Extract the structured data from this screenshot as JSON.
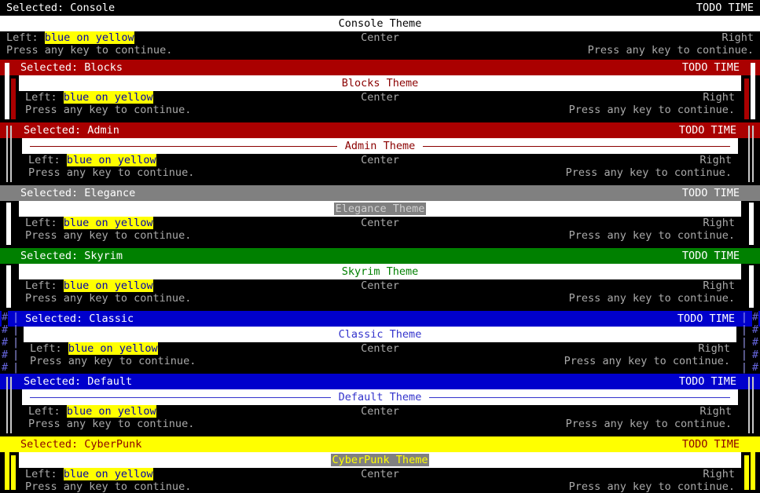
{
  "app": {
    "status_right": "TODO TIME",
    "selected_prefix": "Selected: ",
    "title_suffix": " Theme",
    "line_left_label": "Left: ",
    "line_left_value": "blue on yellow",
    "line_center": "Center",
    "line_right": "Right",
    "line_continue": "Press any key to continue."
  },
  "colors": {
    "black": "#000000",
    "white": "#ffffff",
    "grey_text": "#aaaaaa",
    "yellow": "#ffff00",
    "blue": "#0000aa",
    "maroon": "#aa0000",
    "dark_red_text": "#8b0000",
    "grey": "#808080",
    "light_grey": "#c0c0c0",
    "green": "#008000",
    "navy": "#0000cc"
  },
  "panels": [
    {
      "name": "Console",
      "selected_text": "Selected: Console",
      "title_text": "Console Theme",
      "status_right": "TODO TIME",
      "header_bg": "#000000",
      "header_fg": "#ffffff",
      "title_bg": "#ffffff",
      "title_fg": "#000000",
      "rule_color": "#ffffff",
      "rules": false,
      "border_color": "#000000",
      "border_style": "none",
      "gutter_char": "",
      "gutter_color": "#000000",
      "body_rows": [
        {
          "left_label": "Left: ",
          "left_value": "blue on yellow",
          "center": "Center",
          "right": "Right"
        },
        {
          "left_label": "Press any key to continue.",
          "left_value": "",
          "center": "",
          "right": "Press any key to continue."
        }
      ]
    },
    {
      "name": "Blocks",
      "selected_text": "Selected: Blocks",
      "title_text": "Blocks Theme",
      "status_right": "TODO TIME",
      "header_bg": "#aa0000",
      "header_fg": "#ffffff",
      "title_bg": "#ffffff",
      "title_fg": "#8b0000",
      "rule_color": "#ffffff",
      "rules": false,
      "border_color": "#ffffff",
      "border_style": "block",
      "gutter_char": "",
      "gutter_color": "#aa0000",
      "body_rows": [
        {
          "left_label": "Left: ",
          "left_value": "blue on yellow",
          "center": "Center",
          "right": "Right"
        },
        {
          "left_label": "Press any key to continue.",
          "left_value": "",
          "center": "",
          "right": "Press any key to continue."
        }
      ]
    },
    {
      "name": "Admin",
      "selected_text": "Selected: Admin",
      "title_text": "Admin Theme",
      "status_right": "TODO TIME",
      "header_bg": "#aa0000",
      "header_fg": "#ffffff",
      "title_bg": "#ffffff",
      "title_fg": "#8b0000",
      "rule_color": "#8b0000",
      "rules": true,
      "border_color": "#c8c8c8",
      "border_style": "double",
      "gutter_char": "",
      "gutter_color": "#aa0000",
      "body_rows": [
        {
          "left_label": "Left: ",
          "left_value": "blue on yellow",
          "center": "Center",
          "right": "Right"
        },
        {
          "left_label": "Press any key to continue.",
          "left_value": "",
          "center": "",
          "right": "Press any key to continue."
        }
      ]
    },
    {
      "name": "Elegance",
      "selected_text": "Selected: Elegance",
      "title_text": "Elegance Theme",
      "status_right": "TODO TIME",
      "header_bg": "#808080",
      "header_fg": "#ffffff",
      "title_bg": "#808080",
      "title_fg": "#d0d0d0",
      "rule_color": "#ffffff",
      "rules": false,
      "border_color": "#ffffff",
      "border_style": "thin",
      "gutter_char": "",
      "gutter_color": "#808080",
      "body_rows": [
        {
          "left_label": "Left: ",
          "left_value": "blue on yellow",
          "center": "Center",
          "right": "Right"
        },
        {
          "left_label": "Press any key to continue.",
          "left_value": "",
          "center": "",
          "right": "Press any key to continue."
        }
      ]
    },
    {
      "name": "Skyrim",
      "selected_text": "Selected: Skyrim",
      "title_text": "Skyrim Theme",
      "status_right": "TODO TIME",
      "header_bg": "#008000",
      "header_fg": "#ffffff",
      "title_bg": "#ffffff",
      "title_fg": "#008000",
      "rule_color": "#ffffff",
      "rules": false,
      "border_color": "#ffffff",
      "border_style": "thin",
      "gutter_char": "",
      "gutter_color": "#008000",
      "body_rows": [
        {
          "left_label": "Left: ",
          "left_value": "blue on yellow",
          "center": "Center",
          "right": "Right"
        },
        {
          "left_label": "Press any key to continue.",
          "left_value": "",
          "center": "",
          "right": "Press any key to continue."
        }
      ]
    },
    {
      "name": "Classic",
      "selected_text": "Selected: Classic",
      "title_text": "Classic Theme",
      "status_right": "TODO TIME",
      "header_bg": "#0000cc",
      "header_fg": "#ffffff",
      "title_bg": "#ffffff",
      "title_fg": "#3333cc",
      "rule_color": "#ffffff",
      "rules": false,
      "border_color": "#6666dd",
      "border_style": "pipe",
      "gutter_char": "#",
      "gutter_color": "#6666dd",
      "body_rows": [
        {
          "left_label": "Left: ",
          "left_value": "blue on yellow",
          "center": "Center",
          "right": "Right"
        },
        {
          "left_label": "Press any key to continue.",
          "left_value": "",
          "center": "",
          "right": "Press any key to continue."
        }
      ]
    },
    {
      "name": "Default",
      "selected_text": "Selected: Default",
      "title_text": "Default Theme",
      "status_right": "TODO TIME",
      "header_bg": "#0000cc",
      "header_fg": "#ffffff",
      "title_bg": "#ffffff",
      "title_fg": "#3333cc",
      "rule_color": "#3333cc",
      "rules": true,
      "border_color": "#c8c8c8",
      "border_style": "double",
      "gutter_char": "",
      "gutter_color": "#0000cc",
      "body_rows": [
        {
          "left_label": "Left: ",
          "left_value": "blue on yellow",
          "center": "Center",
          "right": "Right"
        },
        {
          "left_label": "Press any key to continue.",
          "left_value": "",
          "center": "",
          "right": "Press any key to continue."
        }
      ]
    },
    {
      "name": "CyberPunk",
      "selected_text": "Selected: CyberPunk",
      "title_text": "CyberPunk Theme",
      "status_right": "TODO TIME",
      "header_bg": "#ffff00",
      "header_fg": "#8b0000",
      "title_bg": "#808080",
      "title_fg": "#ffff00",
      "rule_color": "#ffff00",
      "rules": false,
      "border_color": "#ffff00",
      "border_style": "block",
      "gutter_char": "",
      "gutter_color": "#ffff00",
      "body_rows": [
        {
          "left_label": "Left: ",
          "left_value": "blue on yellow",
          "center": "Center",
          "right": "Right"
        },
        {
          "left_label": "Press any key to continue.",
          "left_value": "",
          "center": "",
          "right": "Press any key to continue."
        }
      ]
    }
  ]
}
